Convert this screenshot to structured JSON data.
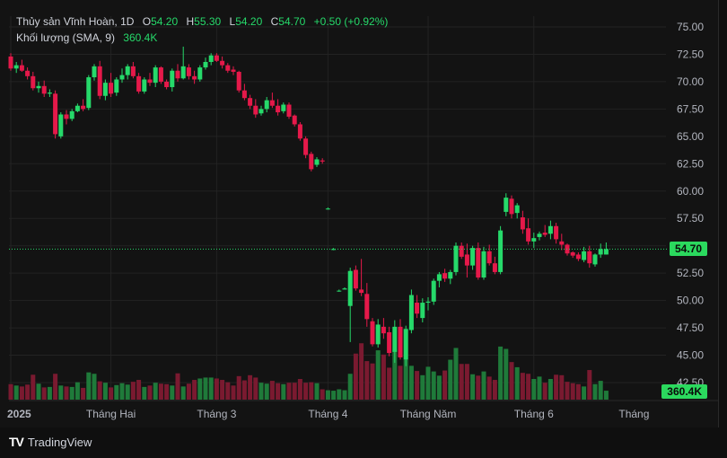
{
  "legend": {
    "symbol": "Thủy sản Vĩnh Hoàn, 1D",
    "open_label": "O",
    "open": "54.20",
    "high_label": "H",
    "high": "55.30",
    "low_label": "L",
    "low": "54.20",
    "close_label": "C",
    "close": "54.70",
    "change": "+0.50 (+0.92%)",
    "volume_label": "Khối lượng (SMA, 9)",
    "volume_value": "360.4K"
  },
  "price_badge": "54.70",
  "volume_badge": "360.4K",
  "brand": {
    "icon": "TV",
    "name": "TradingView"
  },
  "colors": {
    "up": "#26d96a",
    "down": "#e5194a",
    "vol_up": "#1f7a3a",
    "vol_down": "#7a1a30",
    "grid": "#232323",
    "axis_text": "#b2b5be"
  },
  "chart_data": {
    "type": "candlestick",
    "y_ticks": [
      "75.00",
      "72.50",
      "70.00",
      "67.50",
      "65.00",
      "62.50",
      "60.00",
      "57.50",
      "55.00",
      "52.50",
      "50.00",
      "47.50",
      "45.00",
      "42.50"
    ],
    "y_range": [
      41.5,
      76.0
    ],
    "x_ticks": [
      "2025",
      "Tháng Hai",
      "Tháng 3",
      "Tháng 4",
      "Tháng Năm",
      "Tháng 6",
      "Tháng"
    ],
    "x_tick_index": [
      0,
      18,
      37,
      57,
      75,
      94,
      112
    ],
    "last_price": 54.7,
    "candles": [
      [
        72.3,
        72.6,
        71.0,
        71.2
      ],
      [
        71.2,
        71.8,
        70.8,
        71.5
      ],
      [
        71.5,
        72.0,
        70.9,
        71.0
      ],
      [
        71.0,
        71.3,
        70.2,
        70.5
      ],
      [
        70.5,
        70.9,
        69.2,
        69.4
      ],
      [
        69.4,
        70.0,
        69.0,
        69.6
      ],
      [
        69.6,
        70.1,
        68.6,
        68.9
      ],
      [
        68.9,
        69.3,
        68.6,
        69.0
      ],
      [
        68.9,
        69.2,
        64.8,
        65.2
      ],
      [
        65.0,
        67.2,
        64.8,
        67.0
      ],
      [
        67.0,
        67.4,
        66.1,
        66.6
      ],
      [
        66.6,
        67.5,
        66.4,
        67.3
      ],
      [
        67.3,
        68.0,
        67.2,
        67.8
      ],
      [
        67.8,
        68.4,
        67.3,
        67.5
      ],
      [
        67.6,
        70.6,
        67.4,
        70.4
      ],
      [
        70.4,
        71.6,
        70.1,
        71.4
      ],
      [
        71.4,
        71.9,
        68.4,
        68.7
      ],
      [
        68.7,
        70.2,
        68.3,
        69.9
      ],
      [
        69.9,
        70.8,
        68.6,
        68.9
      ],
      [
        69.0,
        70.4,
        68.7,
        70.2
      ],
      [
        70.2,
        71.2,
        69.9,
        70.6
      ],
      [
        70.6,
        71.6,
        70.2,
        71.4
      ],
      [
        71.4,
        71.8,
        70.3,
        70.5
      ],
      [
        70.5,
        70.8,
        68.9,
        69.1
      ],
      [
        69.1,
        70.4,
        68.9,
        70.2
      ],
      [
        70.2,
        70.8,
        69.6,
        69.9
      ],
      [
        69.9,
        71.5,
        69.5,
        71.3
      ],
      [
        71.3,
        71.4,
        69.8,
        70.0
      ],
      [
        70.0,
        70.2,
        69.3,
        69.5
      ],
      [
        69.5,
        71.2,
        69.1,
        71.0
      ],
      [
        71.0,
        71.6,
        70.0,
        70.3
      ],
      [
        70.3,
        73.2,
        70.2,
        71.4
      ],
      [
        71.3,
        71.6,
        70.2,
        70.5
      ],
      [
        70.5,
        71.0,
        69.8,
        70.2
      ],
      [
        70.2,
        71.5,
        70.0,
        71.3
      ],
      [
        71.3,
        72.2,
        71.1,
        71.8
      ],
      [
        71.8,
        72.6,
        71.5,
        72.4
      ],
      [
        72.4,
        72.6,
        71.8,
        71.9
      ],
      [
        71.9,
        72.3,
        71.2,
        71.5
      ],
      [
        71.5,
        71.7,
        70.8,
        71.0
      ],
      [
        71.1,
        71.4,
        70.6,
        70.9
      ],
      [
        70.9,
        71.0,
        69.0,
        69.2
      ],
      [
        69.2,
        69.8,
        68.3,
        68.5
      ],
      [
        68.5,
        68.8,
        67.5,
        67.8
      ],
      [
        67.8,
        68.4,
        66.7,
        67.0
      ],
      [
        67.1,
        67.8,
        66.9,
        67.5
      ],
      [
        67.5,
        68.6,
        67.2,
        68.3
      ],
      [
        68.3,
        69.0,
        67.6,
        67.8
      ],
      [
        67.8,
        68.4,
        66.9,
        67.2
      ],
      [
        67.3,
        68.1,
        67.1,
        67.9
      ],
      [
        67.9,
        68.1,
        66.6,
        66.8
      ],
      [
        66.9,
        67.0,
        65.9,
        66.1
      ],
      [
        66.1,
        66.3,
        64.6,
        64.8
      ],
      [
        64.8,
        65.0,
        63.0,
        63.3
      ],
      [
        63.4,
        63.6,
        61.8,
        62.0
      ],
      [
        62.4,
        63.1,
        62.2,
        62.9
      ],
      [
        62.8,
        63.0,
        62.5,
        62.7
      ],
      [
        58.4,
        58.5,
        58.3,
        58.4
      ],
      [
        54.7,
        54.8,
        54.6,
        54.7
      ],
      [
        50.9,
        51.0,
        50.8,
        50.9
      ],
      [
        51.0,
        51.2,
        51.0,
        51.1
      ],
      [
        49.5,
        53.0,
        46.2,
        52.7
      ],
      [
        52.8,
        53.2,
        50.9,
        51.1
      ],
      [
        51.0,
        53.8,
        50.4,
        50.7
      ],
      [
        50.6,
        51.6,
        47.6,
        48.3
      ],
      [
        48.1,
        48.4,
        45.8,
        46.0
      ],
      [
        46.0,
        48.3,
        45.7,
        47.8
      ],
      [
        47.6,
        48.4,
        46.5,
        47.0
      ],
      [
        47.1,
        47.6,
        44.9,
        45.2
      ],
      [
        45.3,
        48.2,
        44.3,
        47.6
      ],
      [
        47.6,
        48.3,
        44.6,
        44.8
      ],
      [
        44.6,
        47.7,
        44.0,
        47.4
      ],
      [
        47.3,
        51.0,
        47.0,
        50.5
      ],
      [
        49.8,
        50.5,
        48.4,
        48.8
      ],
      [
        48.4,
        50.2,
        48.0,
        49.8
      ],
      [
        49.8,
        50.3,
        49.1,
        49.9
      ],
      [
        49.9,
        52.0,
        49.6,
        51.8
      ],
      [
        51.8,
        52.6,
        51.2,
        52.4
      ],
      [
        52.5,
        52.9,
        51.7,
        52.0
      ],
      [
        52.0,
        52.8,
        51.5,
        52.6
      ],
      [
        52.6,
        55.3,
        52.3,
        55.0
      ],
      [
        55.0,
        55.3,
        53.8,
        54.0
      ],
      [
        54.2,
        55.2,
        52.1,
        53.2
      ],
      [
        53.2,
        55.0,
        52.8,
        54.8
      ],
      [
        54.8,
        55.3,
        51.9,
        52.1
      ],
      [
        52.1,
        54.9,
        51.9,
        54.5
      ],
      [
        54.5,
        55.1,
        53.2,
        53.4
      ],
      [
        53.4,
        54.0,
        52.4,
        52.6
      ],
      [
        52.6,
        56.8,
        52.4,
        56.4
      ],
      [
        58.1,
        59.8,
        57.7,
        59.4
      ],
      [
        59.3,
        59.6,
        57.5,
        57.9
      ],
      [
        58.0,
        58.9,
        57.5,
        58.7
      ],
      [
        57.6,
        58.2,
        56.1,
        56.5
      ],
      [
        56.6,
        57.5,
        55.1,
        55.4
      ],
      [
        55.4,
        56.2,
        54.8,
        55.7
      ],
      [
        55.8,
        56.3,
        55.5,
        56.1
      ],
      [
        56.2,
        56.9,
        55.8,
        56.0
      ],
      [
        56.1,
        57.3,
        55.6,
        56.8
      ],
      [
        56.8,
        57.1,
        55.2,
        55.6
      ],
      [
        55.4,
        56.1,
        54.6,
        55.1
      ],
      [
        55.1,
        55.2,
        54.1,
        54.3
      ],
      [
        54.4,
        54.5,
        53.9,
        54.1
      ],
      [
        54.2,
        54.4,
        53.6,
        53.8
      ],
      [
        53.7,
        54.9,
        53.5,
        54.5
      ],
      [
        54.5,
        55.0,
        53.0,
        53.4
      ],
      [
        53.3,
        54.3,
        53.1,
        54.2
      ],
      [
        54.2,
        55.2,
        53.9,
        54.7
      ],
      [
        54.2,
        55.3,
        54.2,
        54.7
      ]
    ],
    "volume": [
      0.33,
      0.3,
      0.28,
      0.32,
      0.53,
      0.34,
      0.26,
      0.27,
      0.55,
      0.3,
      0.28,
      0.27,
      0.37,
      0.25,
      0.58,
      0.55,
      0.39,
      0.36,
      0.26,
      0.31,
      0.35,
      0.32,
      0.38,
      0.42,
      0.27,
      0.3,
      0.36,
      0.34,
      0.33,
      0.3,
      0.56,
      0.28,
      0.34,
      0.42,
      0.45,
      0.47,
      0.47,
      0.45,
      0.42,
      0.37,
      0.3,
      0.5,
      0.41,
      0.52,
      0.47,
      0.36,
      0.34,
      0.4,
      0.35,
      0.33,
      0.36,
      0.36,
      0.44,
      0.36,
      0.37,
      0.35,
      0.22,
      0.2,
      0.19,
      0.22,
      0.2,
      0.55,
      0.98,
      1.2,
      0.82,
      0.77,
      1.05,
      0.96,
      0.68,
      1.06,
      0.72,
      0.85,
      0.72,
      0.61,
      0.52,
      0.7,
      0.6,
      0.51,
      0.62,
      0.85,
      1.1,
      0.76,
      0.76,
      0.54,
      0.51,
      0.6,
      0.49,
      0.42,
      1.13,
      1.08,
      0.8,
      0.69,
      0.57,
      0.55,
      0.44,
      0.49,
      0.36,
      0.44,
      0.53,
      0.52,
      0.38,
      0.35,
      0.33,
      0.28,
      0.63,
      0.33,
      0.4,
      0.19
    ],
    "volume_max": 1.3
  }
}
